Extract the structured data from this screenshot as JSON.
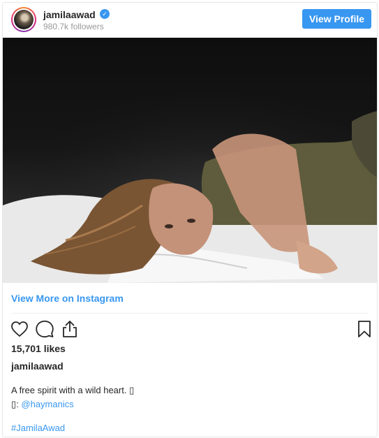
{
  "header": {
    "username": "jamilaawad",
    "followers": "980.7k followers",
    "view_profile_label": "View Profile",
    "verified_glyph": "✓"
  },
  "post": {
    "view_more_label": "View More on Instagram",
    "likes": "15,701 likes",
    "author": "jamilaawad",
    "caption_line1": "A free spirit with a wild heart. ▯",
    "caption_line2_prefix": "▯: ",
    "caption_mention": "@haymanics",
    "hashtag": "#JamilaAwad"
  },
  "icons": {
    "like": "heart-icon",
    "comment": "comment-icon",
    "share": "share-icon",
    "save": "bookmark-icon",
    "verified": "verified-badge-icon"
  },
  "colors": {
    "accent": "#3897f0",
    "text": "#262626",
    "muted": "#999999"
  }
}
